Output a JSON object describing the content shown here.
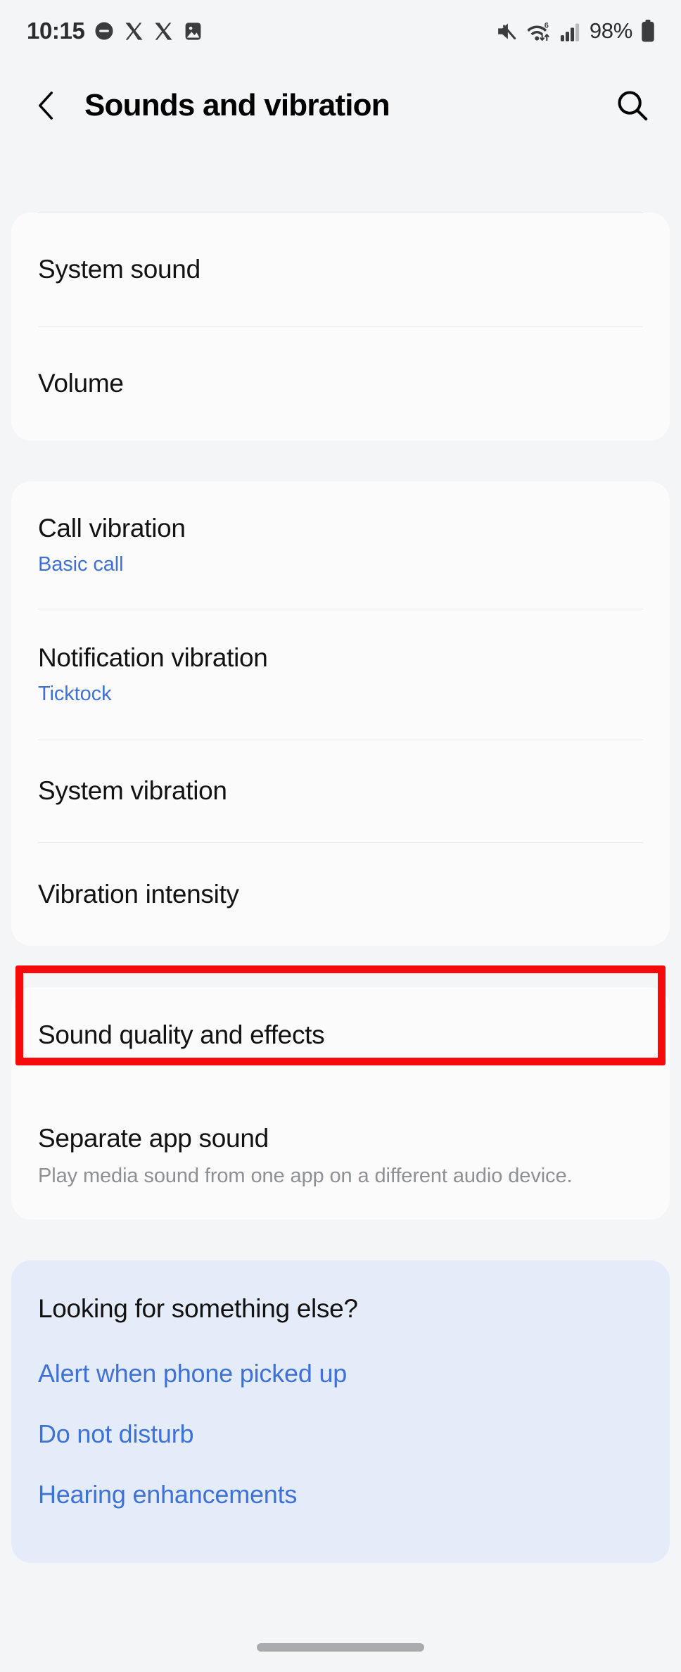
{
  "status_bar": {
    "time": "10:15",
    "battery_percent": "98%",
    "left_icons": [
      "dnd-icon",
      "x-app-icon",
      "x-app-icon",
      "gallery-icon"
    ],
    "right_icons": [
      "mute-icon",
      "wifi6-icon",
      "cellular-signal-icon",
      "battery-icon"
    ]
  },
  "header": {
    "back_label": "Back",
    "title": "Sounds and vibration",
    "search_label": "Search"
  },
  "cards": [
    {
      "id": "sound-card",
      "rows": [
        {
          "title": "System sound",
          "sub": null,
          "desc": null
        },
        {
          "title": "Volume",
          "sub": null,
          "desc": null
        }
      ]
    },
    {
      "id": "vibration-card",
      "rows": [
        {
          "title": "Call vibration",
          "sub": "Basic call",
          "desc": null
        },
        {
          "title": "Notification vibration",
          "sub": "Ticktock",
          "desc": null
        },
        {
          "title": "System vibration",
          "sub": null,
          "desc": null
        },
        {
          "title": "Vibration intensity",
          "sub": null,
          "desc": null
        }
      ]
    },
    {
      "id": "advanced-card",
      "rows": [
        {
          "title": "Sound quality and effects",
          "sub": null,
          "desc": null
        },
        {
          "title": "Separate app sound",
          "sub": null,
          "desc": "Play media sound from one app on a different audio device."
        }
      ]
    }
  ],
  "suggestions": {
    "title": "Looking for something else?",
    "links": [
      "Alert when phone picked up",
      "Do not disturb",
      "Hearing enhancements"
    ]
  },
  "annotation": {
    "highlight_target": "Sound quality and effects",
    "highlight_color": "#f50b0b"
  },
  "colors": {
    "page_background": "#f4f5f7",
    "card_background": "#fbfbfc",
    "blue_card_background": "#e4ebf9",
    "accent_blue": "#3f72d7",
    "text_primary": "#121212",
    "text_secondary": "#8e9094",
    "divider": "#e6e7e9"
  }
}
